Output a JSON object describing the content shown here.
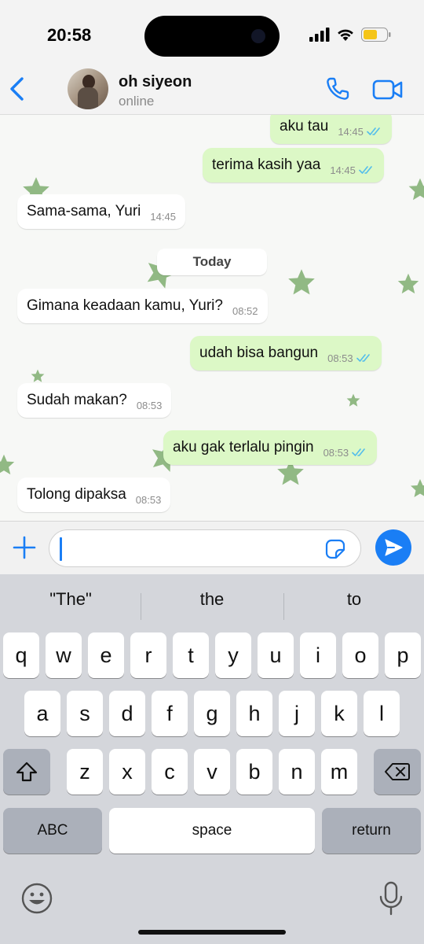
{
  "status_bar": {
    "time": "20:58"
  },
  "header": {
    "contact_name": "oh siyeon",
    "contact_status": "online"
  },
  "date_separator": "Today",
  "messages": [
    {
      "direction": "out",
      "text": "aku tau",
      "time": "14:45",
      "read": true
    },
    {
      "direction": "out",
      "text": "terima kasih yaa",
      "time": "14:45",
      "read": true
    },
    {
      "direction": "in",
      "text": "Sama-sama, Yuri",
      "time": "14:45"
    },
    {
      "direction": "in",
      "text": "Gimana keadaan kamu, Yuri?",
      "time": "08:52"
    },
    {
      "direction": "out",
      "text": "udah bisa bangun",
      "time": "08:53",
      "read": true
    },
    {
      "direction": "in",
      "text": "Sudah makan?",
      "time": "08:53"
    },
    {
      "direction": "out",
      "text": "aku gak terlalu pingin",
      "time": "08:53",
      "read": true
    },
    {
      "direction": "in",
      "text": "Tolong dipaksa",
      "time": "08:53"
    }
  ],
  "composer": {
    "value": ""
  },
  "keyboard": {
    "suggestions": [
      "\"The\"",
      "the",
      "to"
    ],
    "row1": [
      "q",
      "w",
      "e",
      "r",
      "t",
      "y",
      "u",
      "i",
      "o",
      "p"
    ],
    "row2": [
      "a",
      "s",
      "d",
      "f",
      "g",
      "h",
      "j",
      "k",
      "l"
    ],
    "row3": [
      "z",
      "x",
      "c",
      "v",
      "b",
      "n",
      "m"
    ],
    "abc_label": "ABC",
    "space_label": "space",
    "return_label": "return"
  },
  "colors": {
    "accent": "#1a7ef5",
    "outgoing_bubble": "#dcf8c6",
    "incoming_bubble": "#ffffff",
    "read_ticks": "#53bdeb",
    "battery": "#f5c518"
  },
  "icons": [
    "back-chevron-icon",
    "phone-icon",
    "video-camera-icon",
    "plus-icon",
    "sticker-icon",
    "send-icon",
    "shift-icon",
    "backspace-icon",
    "emoji-icon",
    "microphone-icon",
    "double-check-icon",
    "signal-icon",
    "wifi-icon",
    "battery-icon"
  ]
}
